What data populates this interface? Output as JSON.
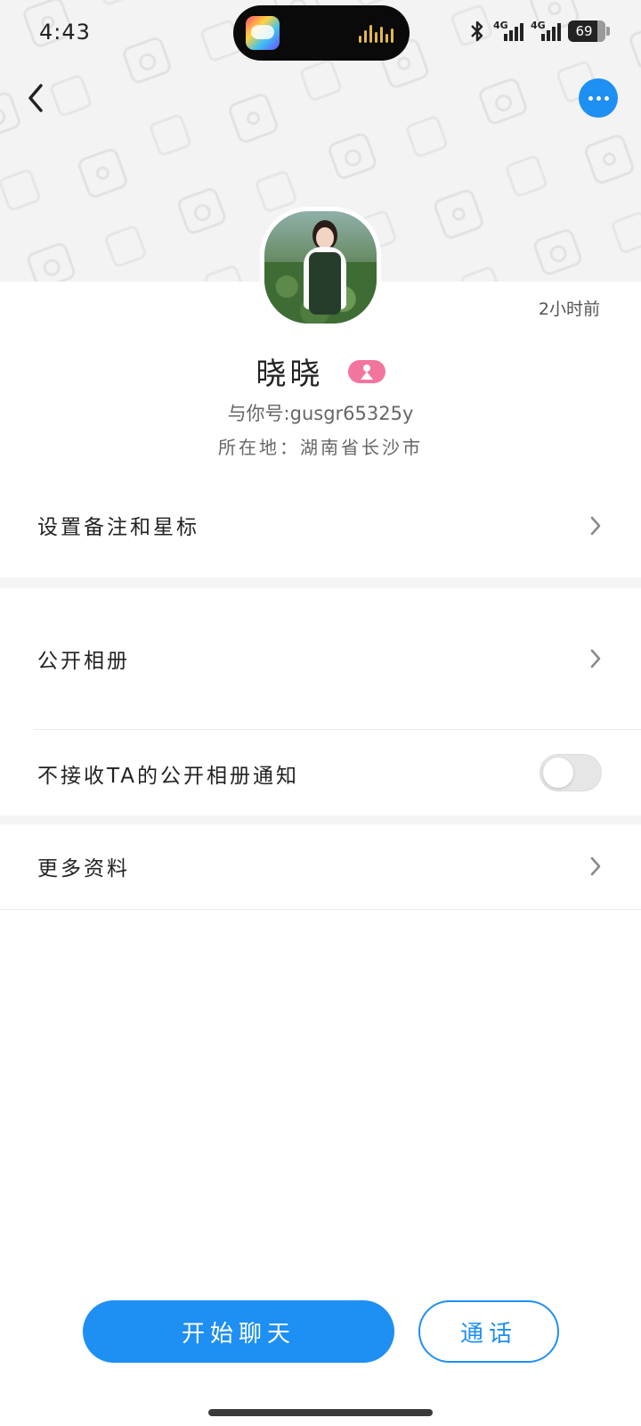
{
  "status_bar": {
    "time": "4:43",
    "network_1": "4G",
    "network_2": "4G",
    "battery": "69"
  },
  "profile": {
    "last_active": "2小时前",
    "name": "晓晓",
    "gender": "female",
    "id_label": "与你号:gusgr65325y",
    "location": "所在地：湖南省长沙市"
  },
  "menu": {
    "remark_label": "设置备注和星标",
    "album_label": "公开相册",
    "album_notify_label": "不接收TA的公开相册通知",
    "album_notify_on": false,
    "more_info_label": "更多资料"
  },
  "actions": {
    "chat_label": "开始聊天",
    "call_label": "通话"
  },
  "colors": {
    "accent": "#1e8ff3",
    "female_badge": "#f2759e"
  }
}
